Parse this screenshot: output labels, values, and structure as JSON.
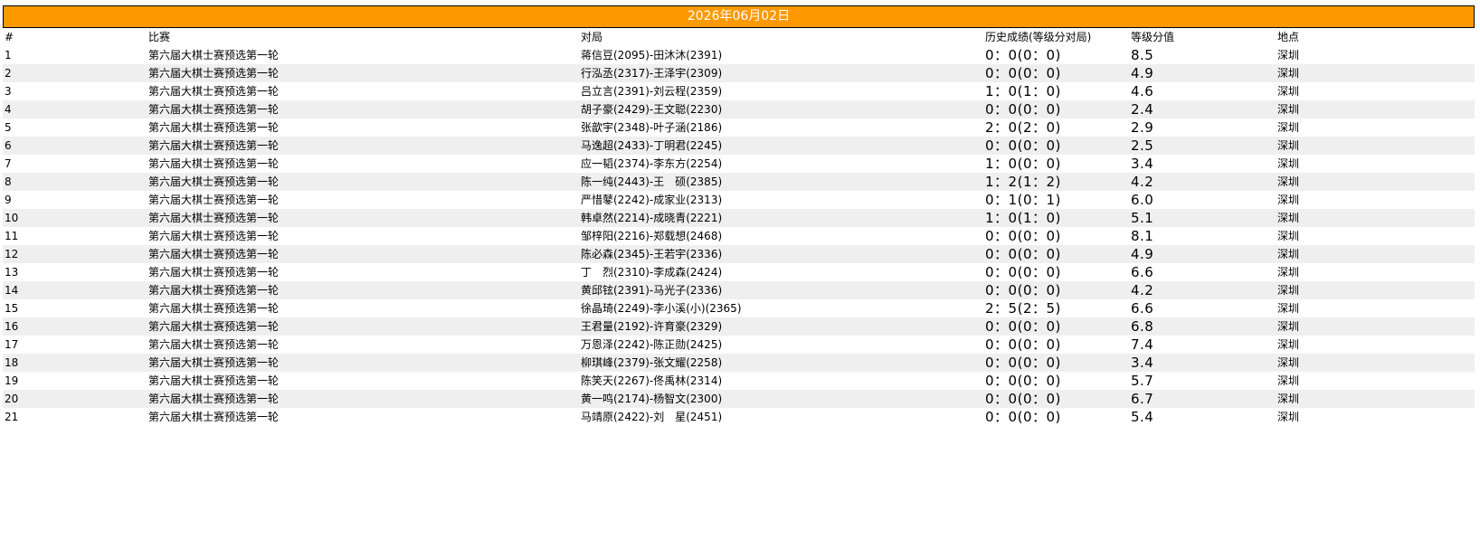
{
  "date_banner": "2026年06月02日",
  "columns": {
    "no": "#",
    "match": "比赛",
    "game": "对局",
    "history": "历史成绩(等级分对局)",
    "grade": "等级分值",
    "place": "地点"
  },
  "rows": [
    {
      "no": "1",
      "match": "第六届大棋士赛预选第一轮",
      "game": "蒋信豆(2095)-田沐沐(2391)",
      "history": "0：0(0：0)",
      "grade": "8.5",
      "place": "深圳"
    },
    {
      "no": "2",
      "match": "第六届大棋士赛预选第一轮",
      "game": "行泓丞(2317)-王泽宇(2309)",
      "history": "0：0(0：0)",
      "grade": "4.9",
      "place": "深圳"
    },
    {
      "no": "3",
      "match": "第六届大棋士赛预选第一轮",
      "game": "吕立言(2391)-刘云程(2359)",
      "history": "1：0(1：0)",
      "grade": "4.6",
      "place": "深圳"
    },
    {
      "no": "4",
      "match": "第六届大棋士赛预选第一轮",
      "game": "胡子豪(2429)-王文聪(2230)",
      "history": "0：0(0：0)",
      "grade": "2.4",
      "place": "深圳"
    },
    {
      "no": "5",
      "match": "第六届大棋士赛预选第一轮",
      "game": "张歆宇(2348)-叶子涵(2186)",
      "history": "2：0(2：0)",
      "grade": "2.9",
      "place": "深圳"
    },
    {
      "no": "6",
      "match": "第六届大棋士赛预选第一轮",
      "game": "马逸超(2433)-丁明君(2245)",
      "history": "0：0(0：0)",
      "grade": "2.5",
      "place": "深圳"
    },
    {
      "no": "7",
      "match": "第六届大棋士赛预选第一轮",
      "game": "应一韬(2374)-李东方(2254)",
      "history": "1：0(0：0)",
      "grade": "3.4",
      "place": "深圳"
    },
    {
      "no": "8",
      "match": "第六届大棋士赛预选第一轮",
      "game": "陈一纯(2443)-王　硕(2385)",
      "history": "1：2(1：2)",
      "grade": "4.2",
      "place": "深圳"
    },
    {
      "no": "9",
      "match": "第六届大棋士赛预选第一轮",
      "game": "严惜鼕(2242)-成家业(2313)",
      "history": "0：1(0：1)",
      "grade": "6.0",
      "place": "深圳"
    },
    {
      "no": "10",
      "match": "第六届大棋士赛预选第一轮",
      "game": "韩卓然(2214)-成晓青(2221)",
      "history": "1：0(1：0)",
      "grade": "5.1",
      "place": "深圳"
    },
    {
      "no": "11",
      "match": "第六届大棋士赛预选第一轮",
      "game": "邹梓阳(2216)-郑载想(2468)",
      "history": "0：0(0：0)",
      "grade": "8.1",
      "place": "深圳"
    },
    {
      "no": "12",
      "match": "第六届大棋士赛预选第一轮",
      "game": "陈必森(2345)-王若宇(2336)",
      "history": "0：0(0：0)",
      "grade": "4.9",
      "place": "深圳"
    },
    {
      "no": "13",
      "match": "第六届大棋士赛预选第一轮",
      "game": "丁　烈(2310)-李成森(2424)",
      "history": "0：0(0：0)",
      "grade": "6.6",
      "place": "深圳"
    },
    {
      "no": "14",
      "match": "第六届大棋士赛预选第一轮",
      "game": "黄邱铉(2391)-马光子(2336)",
      "history": "0：0(0：0)",
      "grade": "4.2",
      "place": "深圳"
    },
    {
      "no": "15",
      "match": "第六届大棋士赛预选第一轮",
      "game": "徐晶琦(2249)-李小溪(小)(2365)",
      "history": "2：5(2：5)",
      "grade": "6.6",
      "place": "深圳"
    },
    {
      "no": "16",
      "match": "第六届大棋士赛预选第一轮",
      "game": "王君量(2192)-许育豪(2329)",
      "history": "0：0(0：0)",
      "grade": "6.8",
      "place": "深圳"
    },
    {
      "no": "17",
      "match": "第六届大棋士赛预选第一轮",
      "game": "万恩泽(2242)-陈正勋(2425)",
      "history": "0：0(0：0)",
      "grade": "7.4",
      "place": "深圳"
    },
    {
      "no": "18",
      "match": "第六届大棋士赛预选第一轮",
      "game": "柳琪峰(2379)-张文耀(2258)",
      "history": "0：0(0：0)",
      "grade": "3.4",
      "place": "深圳"
    },
    {
      "no": "19",
      "match": "第六届大棋士赛预选第一轮",
      "game": "陈笑天(2267)-佟禹林(2314)",
      "history": "0：0(0：0)",
      "grade": "5.7",
      "place": "深圳"
    },
    {
      "no": "20",
      "match": "第六届大棋士赛预选第一轮",
      "game": "黄一鸣(2174)-杨智文(2300)",
      "history": "0：0(0：0)",
      "grade": "6.7",
      "place": "深圳"
    },
    {
      "no": "21",
      "match": "第六届大棋士赛预选第一轮",
      "game": "马靖原(2422)-刘　星(2451)",
      "history": "0：0(0：0)",
      "grade": "5.4",
      "place": "深圳"
    }
  ]
}
